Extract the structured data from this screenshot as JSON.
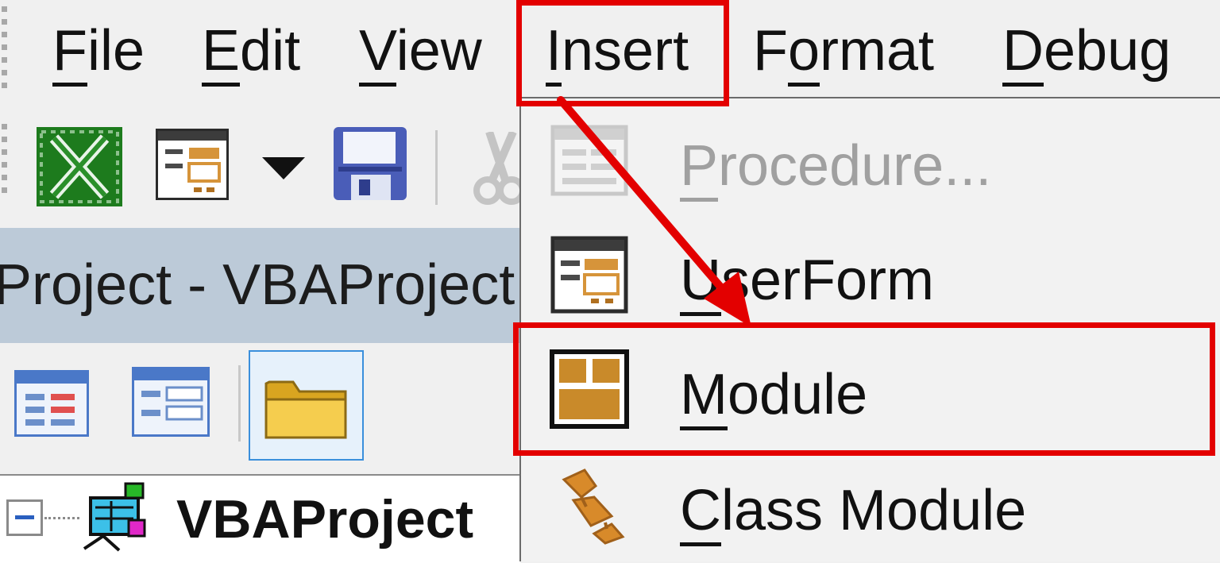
{
  "menubar": {
    "items": [
      {
        "name": "file",
        "pre": "",
        "ul": "F",
        "post": "ile"
      },
      {
        "name": "edit",
        "pre": "",
        "ul": "E",
        "post": "dit"
      },
      {
        "name": "view",
        "pre": "",
        "ul": "V",
        "post": "iew"
      },
      {
        "name": "insert",
        "pre": "",
        "ul": "I",
        "post": "nsert"
      },
      {
        "name": "format",
        "pre": "F",
        "ul": "o",
        "post": "rmat"
      },
      {
        "name": "debug",
        "pre": "",
        "ul": "D",
        "post": "ebug"
      }
    ],
    "highlighted": "Insert"
  },
  "toolbar": {
    "icons": [
      "excel-icon",
      "userform-icon",
      "dropdown-arrow-icon",
      "save-icon",
      "cut-icon"
    ]
  },
  "project_explorer": {
    "title": "Project - VBAProject",
    "buttons": [
      "view-code-icon",
      "view-object-icon",
      "toggle-folders-icon"
    ],
    "tree_root": "VBAProject",
    "tree_expander": "−"
  },
  "insert_menu": {
    "items": [
      {
        "name": "procedure",
        "pre": "",
        "ul": "P",
        "post": "rocedure...",
        "enabled": false
      },
      {
        "name": "userform",
        "pre": "",
        "ul": "U",
        "post": "serForm",
        "enabled": true
      },
      {
        "name": "module",
        "pre": "",
        "ul": "M",
        "post": "odule",
        "enabled": true,
        "highlighted": true
      },
      {
        "name": "class-module",
        "pre": "",
        "ul": "C",
        "post": "lass Module",
        "enabled": true
      }
    ]
  },
  "annotation": {
    "highlight_color": "#e30000",
    "arrow_color": "#e30000"
  }
}
